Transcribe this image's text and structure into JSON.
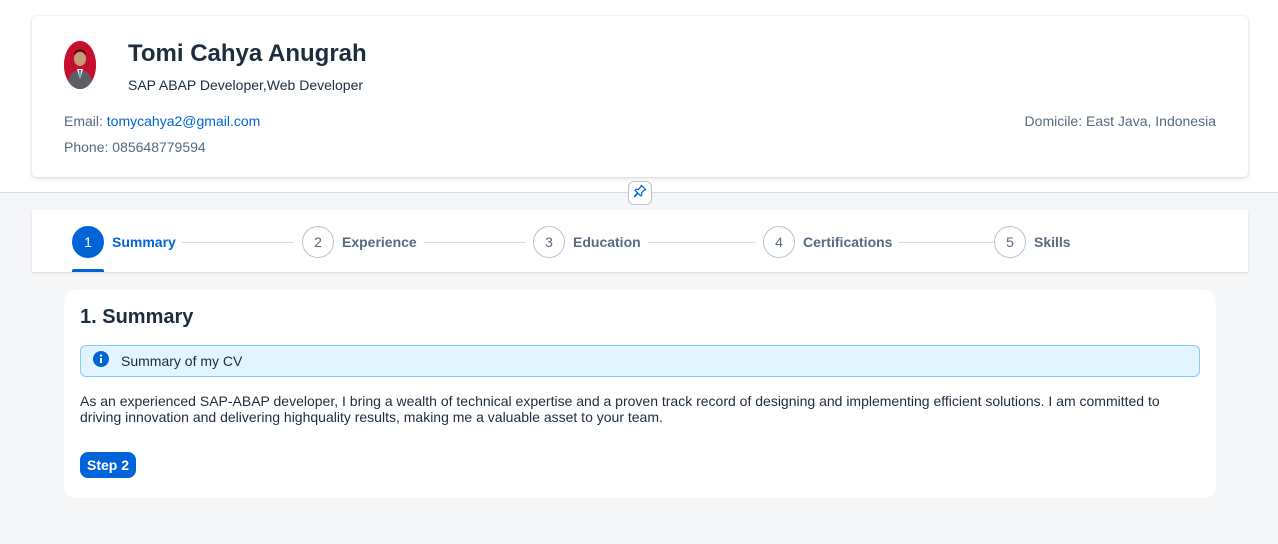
{
  "profile": {
    "name": "Tomi Cahya Anugrah",
    "role": "SAP ABAP Developer,Web Developer",
    "email_label": "Email:",
    "email": "tomycahya2@gmail.com",
    "phone_label": "Phone:",
    "phone": "085648779594",
    "domicile_label": "Domicile:",
    "domicile": "East Java, Indonesia",
    "avatar_icon": "profile-photo"
  },
  "header_pin": {
    "icon": "pin-icon"
  },
  "wizard": {
    "steps": [
      {
        "number": "1",
        "label": "Summary",
        "active": true
      },
      {
        "number": "2",
        "label": "Experience",
        "active": false
      },
      {
        "number": "3",
        "label": "Education",
        "active": false
      },
      {
        "number": "4",
        "label": "Certifications",
        "active": false
      },
      {
        "number": "5",
        "label": "Skills",
        "active": false
      }
    ]
  },
  "section": {
    "title": "1. Summary",
    "info_strip": {
      "icon": "info-icon",
      "text": "Summary of my CV"
    },
    "body": "As an experienced SAP-ABAP developer, I bring a wealth of technical expertise and a proven track record of designing and implementing efficient solutions. I am committed to driving innovation and delivering highquality results, making me a valuable asset to your team.",
    "next_button": "Step 2"
  },
  "colors": {
    "accent": "#0064d9",
    "text": "#1d2d3e",
    "muted": "#556b82",
    "info_bg": "#e1f4ff",
    "info_border": "#7bcfff",
    "avatar_bg": "#c8102e"
  }
}
